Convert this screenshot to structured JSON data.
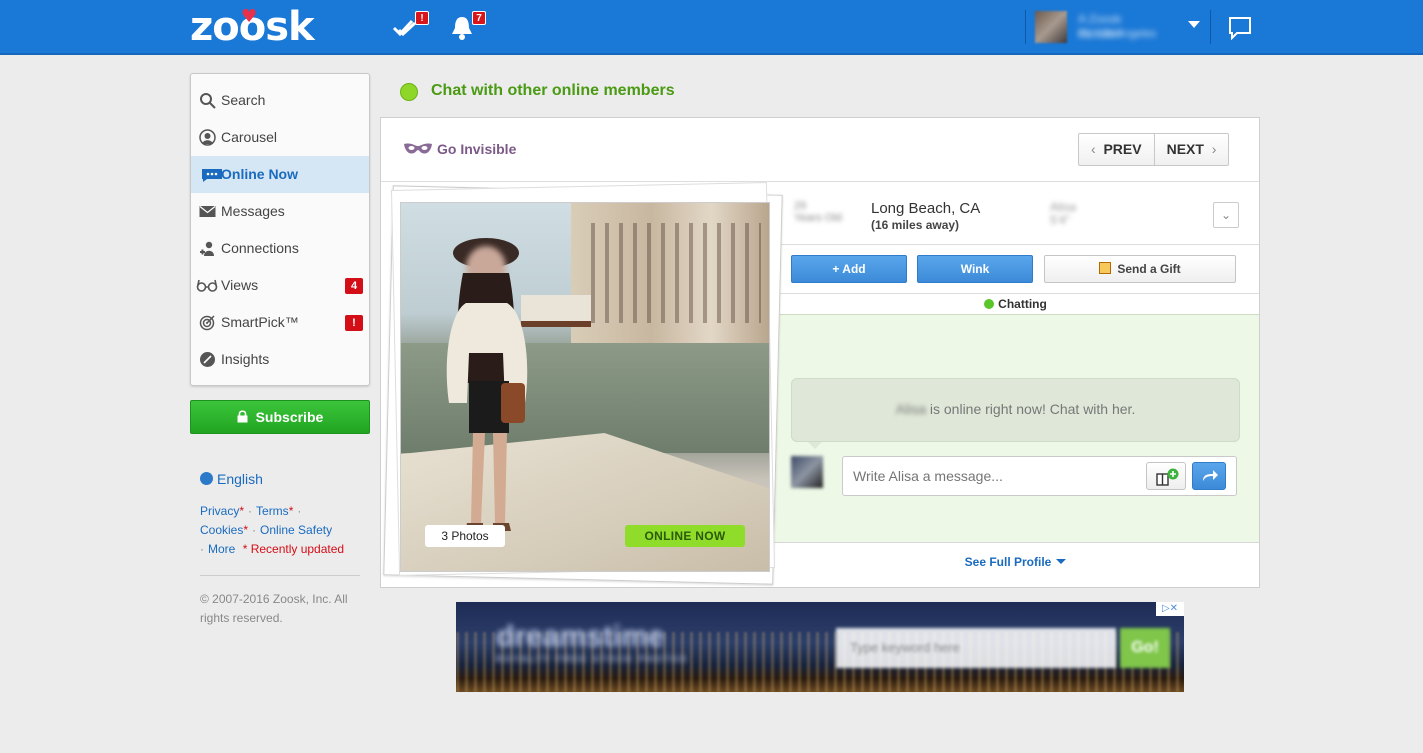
{
  "brand": {
    "logo": "zoosk"
  },
  "header": {
    "checks_badge": "!",
    "notifications_badge": "7",
    "user_name": "A Zoosk member",
    "user_location": "31, Los Angeles"
  },
  "sidebar": {
    "items": [
      {
        "label": "Search",
        "icon": "search-icon"
      },
      {
        "label": "Carousel",
        "icon": "carousel-icon"
      },
      {
        "label": "Online Now",
        "icon": "online-chat-icon"
      },
      {
        "label": "Messages",
        "icon": "envelope-icon"
      },
      {
        "label": "Connections",
        "icon": "connections-icon"
      },
      {
        "label": "Views",
        "icon": "glasses-icon",
        "badge": "4"
      },
      {
        "label": "SmartPick™",
        "icon": "target-icon",
        "badge": "!"
      },
      {
        "label": "Insights",
        "icon": "insights-icon"
      }
    ],
    "subscribe": "Subscribe",
    "language": "English",
    "links": {
      "privacy": "Privacy",
      "terms": "Terms",
      "cookies": "Cookies",
      "online_safety": "Online Safety",
      "more": "More",
      "recently_updated": "* Recently updated"
    },
    "copyright": "© 2007-2016 Zoosk, Inc. All rights reserved."
  },
  "main": {
    "heading": "Chat with other online members",
    "go_invisible": "Go Invisible",
    "prev": "PREV",
    "next": "NEXT",
    "profile": {
      "age": "29",
      "age_sub": "Years Old",
      "location": "Long Beach, CA",
      "distance": "(16 miles away)",
      "name": "Alisa",
      "height": "5'4\"",
      "photos": "3 Photos",
      "status_badge": "ONLINE NOW"
    },
    "actions": {
      "add": "+ Add",
      "wink": "Wink",
      "gift": "Send a Gift"
    },
    "chat": {
      "status": "Chatting",
      "bubble_name": "Alisa",
      "bubble_text": " is online right now! Chat with her.",
      "placeholder": "Write Alisa a message..."
    },
    "see_full_profile": "See Full Profile"
  },
  "ad": {
    "brand": "dreamstime",
    "tagline": "ROYALTY FREE STOCK PHOTOS",
    "search_placeholder": "Type keyword here",
    "go": "Go!"
  }
}
